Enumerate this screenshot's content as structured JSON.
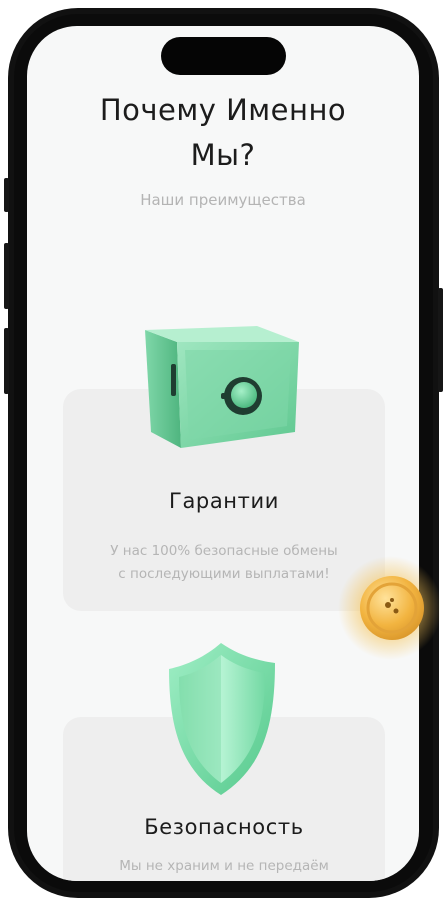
{
  "header": {
    "title_line1": "Почему Именно",
    "title_line2": "Мы?",
    "subtitle": "Наши преимущества"
  },
  "cards": [
    {
      "icon": "safe-icon",
      "title": "Гарантии",
      "text_line1": "У нас 100% безопасные обмены",
      "text_line2": "с последующими выплатами!"
    },
    {
      "icon": "shield-icon",
      "title": "Безопасность",
      "text_line1": "Мы не храним и не передаём"
    }
  ],
  "colors": {
    "accent_green": "#74d9a4",
    "coin_gold": "#f2b440",
    "screen_bg": "#f7f8f8",
    "card_bg": "#eeeeee"
  }
}
